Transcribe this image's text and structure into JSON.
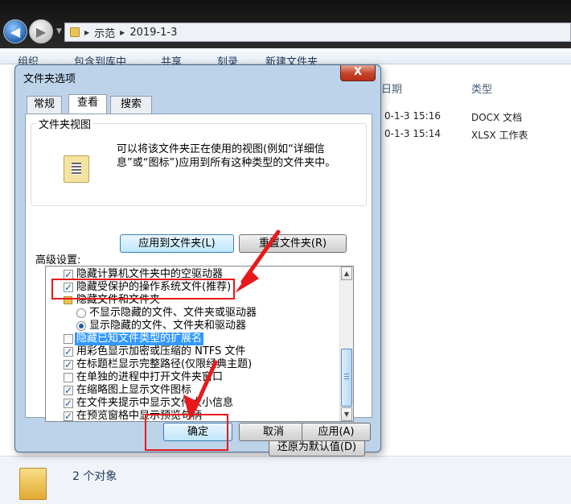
{
  "explorer": {
    "breadcrumb": [
      "示范",
      "2019-1-3"
    ],
    "toolbar": [
      "组织",
      "包含到库中",
      "共享",
      "刻录",
      "新建文件夹"
    ],
    "columns": {
      "date": "日期",
      "type": "类型"
    },
    "files": [
      {
        "date": "0-1-3 15:16",
        "type": "DOCX 文档"
      },
      {
        "date": "0-1-3 15:14",
        "type": "XLSX 工作表"
      }
    ],
    "status": "2 个对象"
  },
  "dialog": {
    "title": "文件夹选项",
    "close_label": "X",
    "tabs": [
      "常规",
      "查看",
      "搜索"
    ],
    "active_tab": "查看",
    "folder_views": {
      "legend": "文件夹视图",
      "description": "可以将该文件夹正在使用的视图(例如“详细信息”或“图标”)应用到所有这种类型的文件夹中。",
      "apply_label": "应用到文件夹(L)",
      "reset_label": "重置文件夹(R)"
    },
    "advanced_label": "高级设置:",
    "settings": [
      {
        "label": "隐藏计算机文件夹中的空驱动器",
        "kind": "checkbox",
        "checked": true
      },
      {
        "label": "隐藏受保护的操作系统文件(推荐)",
        "kind": "checkbox",
        "checked": true
      },
      {
        "label": "隐藏文件和文件夹",
        "kind": "folder",
        "checked": false
      },
      {
        "label": "不显示隐藏的文件、文件夹或驱动器",
        "kind": "radio",
        "checked": false
      },
      {
        "label": "显示隐藏的文件、文件夹和驱动器",
        "kind": "radio",
        "checked": true
      },
      {
        "label": "隐藏已知文件类型的扩展名",
        "kind": "checkbox",
        "checked": false,
        "selected": true
      },
      {
        "label": "用彩色显示加密或压缩的 NTFS 文件",
        "kind": "checkbox",
        "checked": true
      },
      {
        "label": "在标题栏显示完整路径(仅限经典主题)",
        "kind": "checkbox",
        "checked": true
      },
      {
        "label": "在单独的进程中打开文件夹窗口",
        "kind": "checkbox",
        "checked": false
      },
      {
        "label": "在缩略图上显示文件图标",
        "kind": "checkbox",
        "checked": true
      },
      {
        "label": "在文件夹提示中显示文件大小信息",
        "kind": "checkbox",
        "checked": true
      },
      {
        "label": "在预览窗格中显示预览句柄",
        "kind": "checkbox",
        "checked": true
      }
    ],
    "restore_label": "还原为默认值(D)",
    "ok_label": "确定",
    "cancel_label": "取消",
    "apply_label": "应用(A)"
  },
  "colors": {
    "highlight": "#e8191c",
    "selection": "#3399ff",
    "dialog_frame": "#bcd3ea"
  }
}
